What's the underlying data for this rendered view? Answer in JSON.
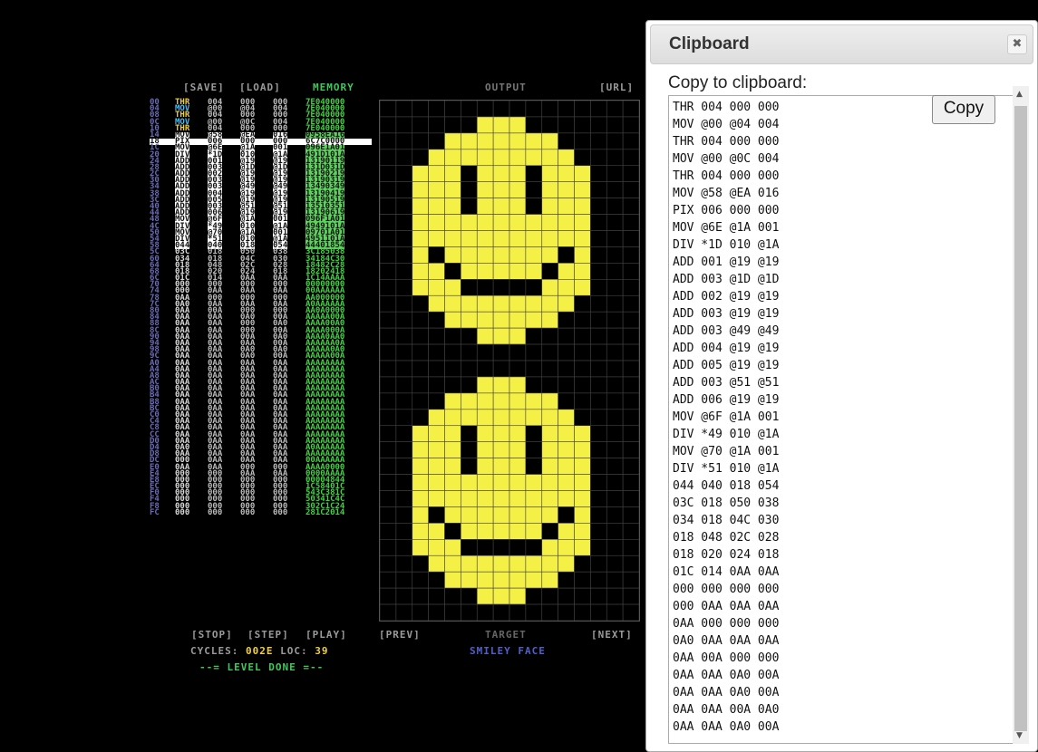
{
  "toolbar": {
    "save": "[SAVE]",
    "load": "[LOAD]",
    "memory": "MEMORY",
    "output": "OUTPUT",
    "url": "[URL]"
  },
  "code_rows": [
    {
      "addr": "00",
      "ins": "THR",
      "a1": "004",
      "a2": "000",
      "a3": "000",
      "hex": "7E040000",
      "style": "thr"
    },
    {
      "addr": "04",
      "ins": "MOV",
      "a1": "@00",
      "a2": "@04",
      "a3": "004",
      "hex": "7E040000",
      "style": "mov0"
    },
    {
      "addr": "08",
      "ins": "THR",
      "a1": "004",
      "a2": "000",
      "a3": "000",
      "hex": "7E040000",
      "style": "thr"
    },
    {
      "addr": "0C",
      "ins": "MOV",
      "a1": "@00",
      "a2": "@0C",
      "a3": "004",
      "hex": "7E040000",
      "style": "mov0"
    },
    {
      "addr": "10",
      "ins": "THR",
      "a1": "004",
      "a2": "000",
      "a3": "000",
      "hex": "7E040000",
      "style": "thr"
    },
    {
      "addr": "14",
      "ins": "MOV",
      "a1": "@58",
      "a2": "@EA",
      "a3": "016",
      "hex": "0958EA16",
      "style": "sel"
    },
    {
      "addr": "18",
      "ins": "PIX",
      "a1": "006",
      "a2": "000",
      "a3": "000",
      "hex": "6C7C0000",
      "style": "cur"
    },
    {
      "addr": "1C",
      "ins": "MOV",
      "a1": "@6E",
      "a2": "@1A",
      "a3": "001",
      "hex": "096E1A01",
      "style": "sel"
    },
    {
      "addr": "20",
      "ins": "DIV",
      "a1": "*1D",
      "a2": "010",
      "a3": "@1A",
      "hex": "491D101A",
      "style": "sel"
    },
    {
      "addr": "24",
      "ins": "ADD",
      "a1": "001",
      "a2": "@19",
      "a3": "@19",
      "hex": "13190119",
      "style": "sel"
    },
    {
      "addr": "28",
      "ins": "ADD",
      "a1": "003",
      "a2": "@1D",
      "a3": "@1D",
      "hex": "131D031D",
      "style": "sel"
    },
    {
      "addr": "2C",
      "ins": "ADD",
      "a1": "002",
      "a2": "@19",
      "a3": "@19",
      "hex": "13190219",
      "style": "sel"
    },
    {
      "addr": "30",
      "ins": "ADD",
      "a1": "003",
      "a2": "@19",
      "a3": "@19",
      "hex": "13190319",
      "style": "sel"
    },
    {
      "addr": "34",
      "ins": "ADD",
      "a1": "003",
      "a2": "@49",
      "a3": "@49",
      "hex": "13490349",
      "style": "sel"
    },
    {
      "addr": "38",
      "ins": "ADD",
      "a1": "004",
      "a2": "@19",
      "a3": "@19",
      "hex": "13190419",
      "style": "sel"
    },
    {
      "addr": "3C",
      "ins": "ADD",
      "a1": "005",
      "a2": "@19",
      "a3": "@19",
      "hex": "13190519",
      "style": "sel"
    },
    {
      "addr": "40",
      "ins": "ADD",
      "a1": "003",
      "a2": "@51",
      "a3": "@51",
      "hex": "13510351",
      "style": "sel"
    },
    {
      "addr": "44",
      "ins": "ADD",
      "a1": "006",
      "a2": "@19",
      "a3": "@19",
      "hex": "13190619",
      "style": "sel"
    },
    {
      "addr": "48",
      "ins": "MOV",
      "a1": "@6F",
      "a2": "@1A",
      "a3": "001",
      "hex": "096F1A01",
      "style": "sel"
    },
    {
      "addr": "4C",
      "ins": "DIV",
      "a1": "*49",
      "a2": "010",
      "a3": "@1A",
      "hex": "4949101A",
      "style": "sel"
    },
    {
      "addr": "50",
      "ins": "MOV",
      "a1": "@70",
      "a2": "@1A",
      "a3": "001",
      "hex": "09701A01",
      "style": "sel"
    },
    {
      "addr": "54",
      "ins": "DIV",
      "a1": "*51",
      "a2": "010",
      "a3": "@1A",
      "hex": "4951101A",
      "style": "sel"
    },
    {
      "addr": "58",
      "ins": "044",
      "a1": "040",
      "a2": "018",
      "a3": "054",
      "hex": "44401854",
      "style": "sel"
    },
    {
      "addr": "5C",
      "ins": "03C",
      "a1": "018",
      "a2": "050",
      "a3": "038",
      "hex": "3C185038",
      "style": ""
    },
    {
      "addr": "60",
      "ins": "034",
      "a1": "018",
      "a2": "04C",
      "a3": "030",
      "hex": "34184C30",
      "style": ""
    },
    {
      "addr": "64",
      "ins": "018",
      "a1": "048",
      "a2": "02C",
      "a3": "028",
      "hex": "18482C28",
      "style": ""
    },
    {
      "addr": "68",
      "ins": "018",
      "a1": "020",
      "a2": "024",
      "a3": "018",
      "hex": "18202418",
      "style": ""
    },
    {
      "addr": "6C",
      "ins": "01C",
      "a1": "014",
      "a2": "0AA",
      "a3": "0AA",
      "hex": "1C14AAAA",
      "style": ""
    },
    {
      "addr": "70",
      "ins": "000",
      "a1": "000",
      "a2": "000",
      "a3": "000",
      "hex": "00000000",
      "style": ""
    },
    {
      "addr": "74",
      "ins": "000",
      "a1": "0AA",
      "a2": "0AA",
      "a3": "0AA",
      "hex": "00AAAAAA",
      "style": ""
    },
    {
      "addr": "78",
      "ins": "0AA",
      "a1": "000",
      "a2": "000",
      "a3": "000",
      "hex": "AA000000",
      "style": ""
    },
    {
      "addr": "7C",
      "ins": "0A0",
      "a1": "0AA",
      "a2": "0AA",
      "a3": "0AA",
      "hex": "A0AAAAAA",
      "style": ""
    },
    {
      "addr": "80",
      "ins": "0AA",
      "a1": "00A",
      "a2": "000",
      "a3": "000",
      "hex": "AA0A0000",
      "style": ""
    },
    {
      "addr": "84",
      "ins": "0AA",
      "a1": "0AA",
      "a2": "0A0",
      "a3": "00A",
      "hex": "AAAAA00A",
      "style": ""
    },
    {
      "addr": "88",
      "ins": "0AA",
      "a1": "0AA",
      "a2": "000",
      "a3": "0A0",
      "hex": "AAAA00A0",
      "style": ""
    },
    {
      "addr": "8C",
      "ins": "0AA",
      "a1": "0AA",
      "a2": "000",
      "a3": "00A",
      "hex": "AAAA000A",
      "style": ""
    },
    {
      "addr": "90",
      "ins": "0AA",
      "a1": "0AA",
      "a2": "00A",
      "a3": "0A0",
      "hex": "AAAA0AA0",
      "style": ""
    },
    {
      "addr": "94",
      "ins": "0AA",
      "a1": "0AA",
      "a2": "0AA",
      "a3": "00A",
      "hex": "AAAAAA0A",
      "style": ""
    },
    {
      "addr": "98",
      "ins": "0AA",
      "a1": "0AA",
      "a2": "0A0",
      "a3": "0A0",
      "hex": "AAAAA0A0",
      "style": ""
    },
    {
      "addr": "9C",
      "ins": "0AA",
      "a1": "0AA",
      "a2": "0A0",
      "a3": "00A",
      "hex": "AAAAA00A",
      "style": ""
    },
    {
      "addr": "A0",
      "ins": "0AA",
      "a1": "0AA",
      "a2": "0AA",
      "a3": "0AA",
      "hex": "AAAAAAAA",
      "style": ""
    },
    {
      "addr": "A4",
      "ins": "0AA",
      "a1": "0AA",
      "a2": "0AA",
      "a3": "0AA",
      "hex": "AAAAAAAA",
      "style": ""
    },
    {
      "addr": "A8",
      "ins": "0AA",
      "a1": "0AA",
      "a2": "0AA",
      "a3": "0AA",
      "hex": "AAAAAAAA",
      "style": ""
    },
    {
      "addr": "AC",
      "ins": "0AA",
      "a1": "0AA",
      "a2": "0AA",
      "a3": "0AA",
      "hex": "AAAAAAAA",
      "style": ""
    },
    {
      "addr": "B0",
      "ins": "0AA",
      "a1": "0AA",
      "a2": "0AA",
      "a3": "0AA",
      "hex": "AAAAAAAA",
      "style": ""
    },
    {
      "addr": "B4",
      "ins": "0AA",
      "a1": "0AA",
      "a2": "0AA",
      "a3": "0AA",
      "hex": "AAAAAAAA",
      "style": ""
    },
    {
      "addr": "B8",
      "ins": "0AA",
      "a1": "0AA",
      "a2": "0AA",
      "a3": "0AA",
      "hex": "AAAAAAAA",
      "style": ""
    },
    {
      "addr": "BC",
      "ins": "0AA",
      "a1": "0AA",
      "a2": "0AA",
      "a3": "0AA",
      "hex": "AAAAAAAA",
      "style": ""
    },
    {
      "addr": "C0",
      "ins": "0AA",
      "a1": "0AA",
      "a2": "0AA",
      "a3": "0AA",
      "hex": "AAAAAAAA",
      "style": ""
    },
    {
      "addr": "C4",
      "ins": "0AA",
      "a1": "0AA",
      "a2": "0AA",
      "a3": "0AA",
      "hex": "AAAAAAAA",
      "style": ""
    },
    {
      "addr": "C8",
      "ins": "0AA",
      "a1": "0AA",
      "a2": "0AA",
      "a3": "0AA",
      "hex": "AAAAAAAA",
      "style": ""
    },
    {
      "addr": "CC",
      "ins": "0AA",
      "a1": "0AA",
      "a2": "0AA",
      "a3": "0AA",
      "hex": "AAAAAAAA",
      "style": ""
    },
    {
      "addr": "D0",
      "ins": "0AA",
      "a1": "0AA",
      "a2": "0AA",
      "a3": "0AA",
      "hex": "AAAAAAAA",
      "style": ""
    },
    {
      "addr": "D4",
      "ins": "0A0",
      "a1": "0AA",
      "a2": "0AA",
      "a3": "0AA",
      "hex": "A0AAAAAA",
      "style": ""
    },
    {
      "addr": "D8",
      "ins": "0AA",
      "a1": "0AA",
      "a2": "0AA",
      "a3": "0AA",
      "hex": "AAAAAAAA",
      "style": ""
    },
    {
      "addr": "DC",
      "ins": "000",
      "a1": "0AA",
      "a2": "0AA",
      "a3": "0AA",
      "hex": "00AAAAAA",
      "style": ""
    },
    {
      "addr": "E0",
      "ins": "0AA",
      "a1": "0AA",
      "a2": "000",
      "a3": "000",
      "hex": "AAAA0000",
      "style": ""
    },
    {
      "addr": "E4",
      "ins": "000",
      "a1": "000",
      "a2": "0AA",
      "a3": "0AA",
      "hex": "0000AAAA",
      "style": ""
    },
    {
      "addr": "E8",
      "ins": "000",
      "a1": "000",
      "a2": "000",
      "a3": "000",
      "hex": "00004844",
      "style": ""
    },
    {
      "addr": "EC",
      "ins": "000",
      "a1": "000",
      "a2": "000",
      "a3": "000",
      "hex": "1C58401C",
      "style": ""
    },
    {
      "addr": "F0",
      "ins": "000",
      "a1": "000",
      "a2": "000",
      "a3": "000",
      "hex": "543C381C",
      "style": ""
    },
    {
      "addr": "F4",
      "ins": "000",
      "a1": "000",
      "a2": "000",
      "a3": "000",
      "hex": "50341C4C",
      "style": ""
    },
    {
      "addr": "F8",
      "ins": "000",
      "a1": "000",
      "a2": "000",
      "a3": "000",
      "hex": "302C1C24",
      "style": ""
    },
    {
      "addr": "FC",
      "ins": "000",
      "a1": "000",
      "a2": "000",
      "a3": "000",
      "hex": "281C2014",
      "style": ""
    }
  ],
  "controls": {
    "stop": "[STOP]",
    "step": "[STEP]",
    "play": "[PLAY]",
    "prev": "[PREV]",
    "target": "TARGET",
    "next": "[NEXT]"
  },
  "status": {
    "cycles_label": "CYCLES:",
    "cycles_value": "002E",
    "loc_label": "LOC:",
    "loc_value": "39",
    "level_done": "--= LEVEL DONE =--",
    "target_name": "SMILEY FACE"
  },
  "face_rows": [
    "...........",
    "....XXX....",
    "..XXXXXXX..",
    ".XXXXXXXXX.",
    "XXX.XXX.XXX",
    "XXX.XXX.XXX",
    "XXX.XXX.XXX",
    "XXXXXXXXXXX",
    "XXXXXXXXXXX",
    "X.XXXXXXX.X",
    "XX.XXXXX.XX",
    "XXX.....XXX",
    ".XXXXXXXXX.",
    "..XXXXXXX..",
    "....XXX...."
  ],
  "colors": {
    "face": "#f5f046",
    "grid": "#444444",
    "memory_green": "#3fc85a",
    "accent_yellow": "#f0d040"
  },
  "dialog": {
    "title": "Clipboard",
    "close": "✖",
    "copy_label": "Copy to clipboard:",
    "copy_button": "Copy",
    "text": "THR 004 000 000\nMOV @00 @04 004\nTHR 004 000 000\nMOV @00 @0C 004\nTHR 004 000 000\nMOV @58 @EA 016\nPIX 006 000 000\nMOV @6E @1A 001\nDIV *1D 010 @1A\nADD 001 @19 @19\nADD 003 @1D @1D\nADD 002 @19 @19\nADD 003 @19 @19\nADD 003 @49 @49\nADD 004 @19 @19\nADD 005 @19 @19\nADD 003 @51 @51\nADD 006 @19 @19\nMOV @6F @1A 001\nDIV *49 010 @1A\nMOV @70 @1A 001\nDIV *51 010 @1A\n044 040 018 054\n03C 018 050 038\n034 018 04C 030\n018 048 02C 028\n018 020 024 018\n01C 014 0AA 0AA\n000 000 000 000\n000 0AA 0AA 0AA\n0AA 000 000 000\n0A0 0AA 0AA 0AA\n0AA 00A 000 000\n0AA 0AA 0A0 00A\n0AA 0AA 0A0 00A\n0AA 0AA 00A 0A0\n0AA 0AA 0A0 00A"
  }
}
